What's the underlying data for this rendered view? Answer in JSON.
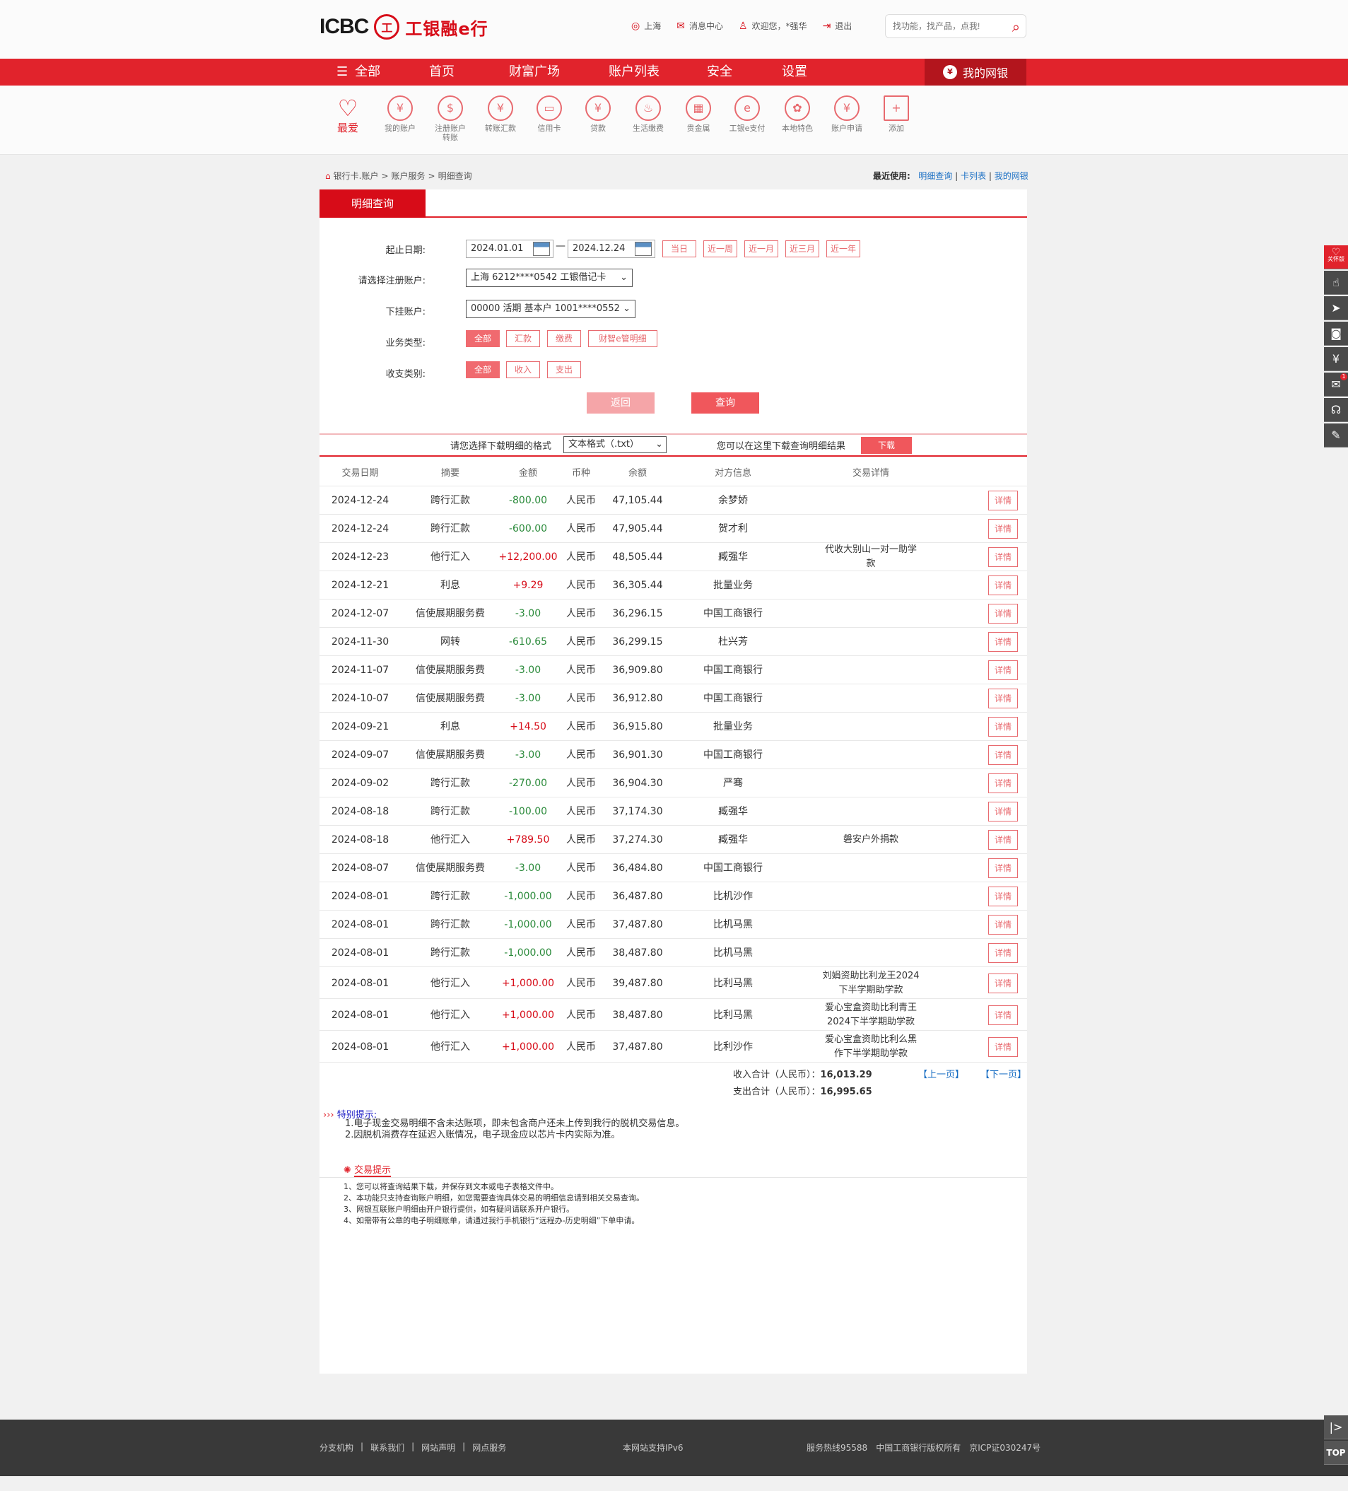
{
  "header": {
    "logo_text": "ICBC",
    "seal_text": "工",
    "slogan": "工银融e行",
    "links": [
      {
        "icon": "location-icon",
        "glyph": "◎",
        "label": "上海"
      },
      {
        "icon": "mail-icon",
        "glyph": "✉",
        "label": "消息中心"
      },
      {
        "icon": "user-icon",
        "glyph": "♙",
        "label": "欢迎您，*强华"
      },
      {
        "icon": "logout-icon",
        "glyph": "⇥",
        "label": "退出"
      }
    ],
    "search_placeholder": "找功能，找产品，点我!"
  },
  "nav": {
    "items": [
      "全部",
      "首页",
      "财富广场",
      "账户列表",
      "安全",
      "设置"
    ],
    "mybank": "我的网银",
    "mybank_glyph": "¥"
  },
  "favorites": [
    {
      "label": "最爱",
      "glyph": "♡",
      "icon": "heart-icon"
    },
    {
      "label": "我的账户",
      "glyph": "¥",
      "icon": "account-icon"
    },
    {
      "label": "注册账户转账",
      "glyph": "$",
      "icon": "transfer-register-icon"
    },
    {
      "label": "转账汇款",
      "glyph": "¥",
      "icon": "remittance-icon"
    },
    {
      "label": "信用卡",
      "glyph": "▭",
      "icon": "credit-card-icon"
    },
    {
      "label": "贷款",
      "glyph": "¥",
      "icon": "loan-icon"
    },
    {
      "label": "生活缴费",
      "glyph": "♨",
      "icon": "utility-icon"
    },
    {
      "label": "贵金属",
      "glyph": "▦",
      "icon": "gold-icon"
    },
    {
      "label": "工银e支付",
      "glyph": "e",
      "icon": "epay-icon"
    },
    {
      "label": "本地特色",
      "glyph": "✿",
      "icon": "local-icon"
    },
    {
      "label": "账户申请",
      "glyph": "¥",
      "icon": "apply-icon"
    },
    {
      "label": "添加",
      "glyph": "+",
      "icon": "add-icon"
    }
  ],
  "breadcrumb": {
    "parts": [
      "银行卡.账户",
      ">",
      "账户服务",
      ">",
      "明细查询"
    ]
  },
  "recent": {
    "label": "最近使用:",
    "links": [
      "明细查询",
      "卡列表",
      "我的网银"
    ],
    "sep": "|"
  },
  "tab": "明细查询",
  "form": {
    "date_label": "起止日期:",
    "start_date": "2024.01.01",
    "end_date": "2024.12.24",
    "dash": "—",
    "quick": [
      "当日",
      "近一周",
      "近一月",
      "近三月",
      "近一年"
    ],
    "account_label": "请选择注册账户:",
    "account_value": "上海 6212****0542 工银借记卡",
    "sub_label": "下挂账户:",
    "sub_value": "00000 活期 基本户 1001****0552",
    "biz_label": "业务类型:",
    "biz_options": [
      "全部",
      "汇款",
      "缴费",
      "财智e管明细"
    ],
    "io_label": "收支类别:",
    "io_options": [
      "全部",
      "收入",
      "支出"
    ],
    "back_btn": "返回",
    "query_btn": "查询"
  },
  "download": {
    "format_label": "请您选择下载明细的格式",
    "format_value": "文本格式（.txt）",
    "hint": "您可以在这里下载查询明细结果",
    "btn": "下载"
  },
  "table": {
    "headers": [
      "交易日期",
      "摘要",
      "金额",
      "币种",
      "余额",
      "对方信息",
      "交易详情"
    ],
    "detail_label": "详情",
    "rows": [
      {
        "date": "2024-12-24",
        "summary": "跨行汇款",
        "amount": "-800.00",
        "cur": "人民币",
        "balance": "47,105.44",
        "party": "余梦娇",
        "detail": ""
      },
      {
        "date": "2024-12-24",
        "summary": "跨行汇款",
        "amount": "-600.00",
        "cur": "人民币",
        "balance": "47,905.44",
        "party": "贺才利",
        "detail": ""
      },
      {
        "date": "2024-12-23",
        "summary": "他行汇入",
        "amount": "+12,200.00",
        "cur": "人民币",
        "balance": "48,505.44",
        "party": "臧强华",
        "detail": "代收大别山一对一助学款"
      },
      {
        "date": "2024-12-21",
        "summary": "利息",
        "amount": "+9.29",
        "cur": "人民币",
        "balance": "36,305.44",
        "party": "批量业务",
        "detail": ""
      },
      {
        "date": "2024-12-07",
        "summary": "信使展期服务费",
        "amount": "-3.00",
        "cur": "人民币",
        "balance": "36,296.15",
        "party": "中国工商银行",
        "detail": ""
      },
      {
        "date": "2024-11-30",
        "summary": "网转",
        "amount": "-610.65",
        "cur": "人民币",
        "balance": "36,299.15",
        "party": "杜兴芳",
        "detail": ""
      },
      {
        "date": "2024-11-07",
        "summary": "信使展期服务费",
        "amount": "-3.00",
        "cur": "人民币",
        "balance": "36,909.80",
        "party": "中国工商银行",
        "detail": ""
      },
      {
        "date": "2024-10-07",
        "summary": "信使展期服务费",
        "amount": "-3.00",
        "cur": "人民币",
        "balance": "36,912.80",
        "party": "中国工商银行",
        "detail": ""
      },
      {
        "date": "2024-09-21",
        "summary": "利息",
        "amount": "+14.50",
        "cur": "人民币",
        "balance": "36,915.80",
        "party": "批量业务",
        "detail": ""
      },
      {
        "date": "2024-09-07",
        "summary": "信使展期服务费",
        "amount": "-3.00",
        "cur": "人民币",
        "balance": "36,901.30",
        "party": "中国工商银行",
        "detail": ""
      },
      {
        "date": "2024-09-02",
        "summary": "跨行汇款",
        "amount": "-270.00",
        "cur": "人民币",
        "balance": "36,904.30",
        "party": "严骞",
        "detail": ""
      },
      {
        "date": "2024-08-18",
        "summary": "跨行汇款",
        "amount": "-100.00",
        "cur": "人民币",
        "balance": "37,174.30",
        "party": "臧强华",
        "detail": ""
      },
      {
        "date": "2024-08-18",
        "summary": "他行汇入",
        "amount": "+789.50",
        "cur": "人民币",
        "balance": "37,274.30",
        "party": "臧强华",
        "detail": "磐安户外捐款"
      },
      {
        "date": "2024-08-07",
        "summary": "信使展期服务费",
        "amount": "-3.00",
        "cur": "人民币",
        "balance": "36,484.80",
        "party": "中国工商银行",
        "detail": ""
      },
      {
        "date": "2024-08-01",
        "summary": "跨行汇款",
        "amount": "-1,000.00",
        "cur": "人民币",
        "balance": "36,487.80",
        "party": "比机沙作",
        "detail": ""
      },
      {
        "date": "2024-08-01",
        "summary": "跨行汇款",
        "amount": "-1,000.00",
        "cur": "人民币",
        "balance": "37,487.80",
        "party": "比机马黑",
        "detail": ""
      },
      {
        "date": "2024-08-01",
        "summary": "跨行汇款",
        "amount": "-1,000.00",
        "cur": "人民币",
        "balance": "38,487.80",
        "party": "比机马黑",
        "detail": ""
      },
      {
        "date": "2024-08-01",
        "summary": "他行汇入",
        "amount": "+1,000.00",
        "cur": "人民币",
        "balance": "39,487.80",
        "party": "比利马黑",
        "detail": "刘娟资助比利龙王2024下半学期助学款"
      },
      {
        "date": "2024-08-01",
        "summary": "他行汇入",
        "amount": "+1,000.00",
        "cur": "人民币",
        "balance": "38,487.80",
        "party": "比利马黑",
        "detail": "爱心宝盒资助比利青王2024下半学期助学款"
      },
      {
        "date": "2024-08-01",
        "summary": "他行汇入",
        "amount": "+1,000.00",
        "cur": "人民币",
        "balance": "37,487.80",
        "party": "比利沙作",
        "detail": "爱心宝盒资助比利么黑作下半学期助学款"
      }
    ]
  },
  "totals": {
    "income_label": "收入合计（人民币）：",
    "income": "16,013.29",
    "expense_label": "支出合计（人民币）：",
    "expense": "16,995.65",
    "prev": "【上一页】",
    "next": "【下一页】"
  },
  "special": {
    "title": "特别提示:",
    "lines": [
      "1.电子现金交易明细不含未达账项，即未包含商户还未上传到我行的脱机交易信息。",
      "2.因脱机消费存在延迟入账情况，电子现金应以芯片卡内实际为准。"
    ]
  },
  "tips": {
    "title": "交易提示",
    "lines": [
      "1、您可以将查询结果下载，并保存到文本或电子表格文件中。",
      "2、本功能只支持查询账户明细，如您需要查询具体交易的明细信息请到相关交易查询。",
      "3、网银互联账户明细由开户银行提供，如有疑问请联系开户银行。",
      "4、如需带有公章的电子明细账单，请通过我行手机银行“远程办-历史明细”下单申请。"
    ]
  },
  "sidebar": [
    {
      "icon": "care-mode-icon",
      "glyph": "♡",
      "label": "关怀版"
    },
    {
      "icon": "service-hand-icon",
      "glyph": "☝",
      "label": ""
    },
    {
      "icon": "send-icon",
      "glyph": "➤",
      "label": ""
    },
    {
      "icon": "camera-icon",
      "glyph": "◙",
      "label": ""
    },
    {
      "icon": "calendar-money-icon",
      "glyph": "¥",
      "label": ""
    },
    {
      "icon": "message-icon",
      "glyph": "✉",
      "label": ""
    },
    {
      "icon": "headset-icon",
      "glyph": "☊",
      "label": ""
    },
    {
      "icon": "note-icon",
      "glyph": "✎",
      "label": ""
    }
  ],
  "message_badge": "1",
  "corner": {
    "collapse": "|>",
    "top": "TOP"
  },
  "footer": {
    "links": [
      "分支机构",
      "联系我们",
      "网站声明",
      "网点服务"
    ],
    "sep": "|",
    "ipv6": "本网站支持IPv6",
    "hotline": "服务热线95588",
    "copyright": "中国工商银行版权所有",
    "icp": "京ICP证030247号"
  },
  "colors": {
    "brand_red": "#e1232c",
    "income": "#d70c18",
    "expense": "#2a8a3a"
  }
}
